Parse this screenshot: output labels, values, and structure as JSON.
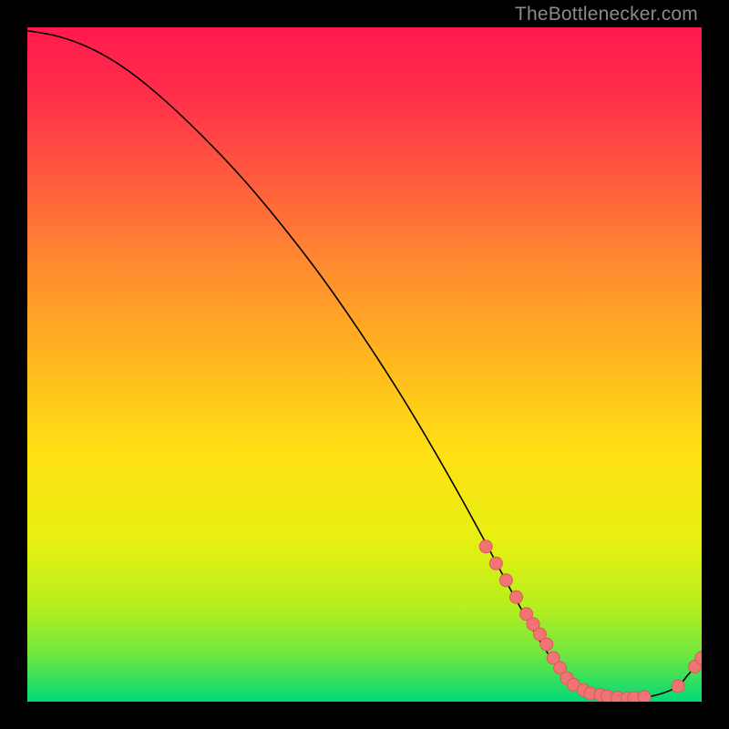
{
  "attribution": "TheBottlenecker.com",
  "chart_data": {
    "type": "line",
    "title": "",
    "xlabel": "",
    "ylabel": "",
    "xlim": [
      0,
      100
    ],
    "ylim": [
      0,
      100
    ],
    "background_gradient": {
      "top": "#ff1a4d",
      "mid": "#ffd400",
      "bottom": "#00d97a"
    },
    "series": [
      {
        "name": "curve",
        "x": [
          0,
          4,
          8,
          12,
          16,
          20,
          24,
          28,
          32,
          36,
          40,
          44,
          48,
          52,
          56,
          60,
          64,
          68,
          72,
          76,
          80,
          84,
          88,
          92,
          96,
          98,
          100
        ],
        "y": [
          99.5,
          98.8,
          97.5,
          95.5,
          92.8,
          89.5,
          85.8,
          81.8,
          77.5,
          72.8,
          67.8,
          62.5,
          56.8,
          50.8,
          44.5,
          37.8,
          30.8,
          23.5,
          16.0,
          9.0,
          3.5,
          1.0,
          0.5,
          0.7,
          2.0,
          4.0,
          6.5
        ]
      }
    ],
    "markers": [
      {
        "name": "cluster-descent",
        "x": [
          68.0,
          69.5,
          71.0,
          72.5,
          74.0,
          75.0,
          76.0,
          77.0,
          78.0,
          79.0
        ],
        "y": [
          23.0,
          20.5,
          18.0,
          15.5,
          13.0,
          11.5,
          10.0,
          8.5,
          6.5,
          5.0
        ]
      },
      {
        "name": "cluster-valley",
        "x": [
          80.0,
          81.0,
          82.5,
          83.5,
          85.0,
          86.0,
          87.5,
          89.0,
          90.0,
          91.5
        ],
        "y": [
          3.5,
          2.5,
          1.7,
          1.2,
          1.0,
          0.8,
          0.6,
          0.5,
          0.55,
          0.7
        ]
      },
      {
        "name": "rise-point-1",
        "x": [
          96.5
        ],
        "y": [
          2.3
        ]
      },
      {
        "name": "rise-point-2",
        "x": [
          99.0
        ],
        "y": [
          5.2
        ]
      },
      {
        "name": "rise-point-3",
        "x": [
          100.0
        ],
        "y": [
          6.5
        ]
      }
    ],
    "marker_style": {
      "fill": "#f07474",
      "stroke": "#d85b5b",
      "r": 7
    },
    "line_style": {
      "stroke": "#000000",
      "width": 1.6
    }
  }
}
